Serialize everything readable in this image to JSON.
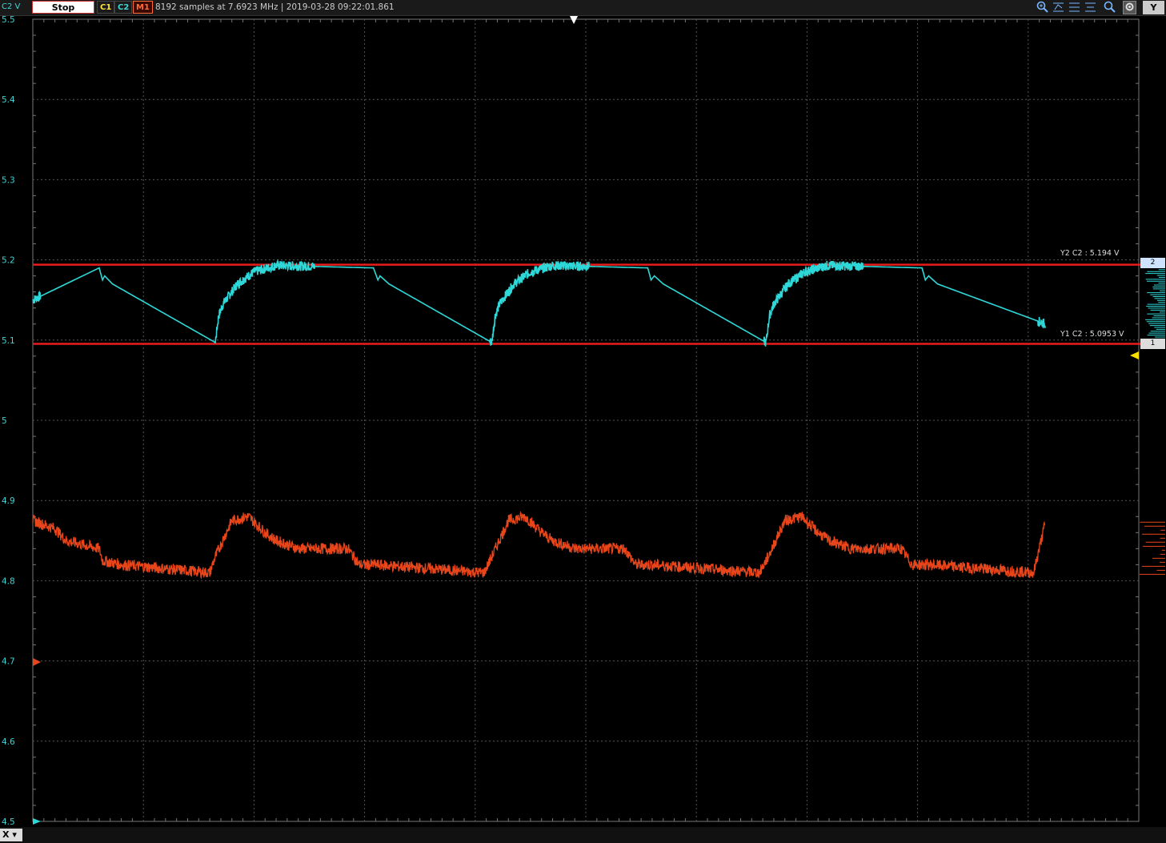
{
  "toolbar": {
    "axis_label": "C2 V",
    "stop_label": "Stop",
    "channels": [
      "C1",
      "C2",
      "M1"
    ],
    "status": "8192 samples at 7.6923 MHz | 2019-03-28 09:22:01.861",
    "y_button": "Y"
  },
  "bottombar": {
    "x_button": "X"
  },
  "cursors": {
    "y2_label": "Y2 C2 : 5.194 V",
    "y1_label": "Y1 C2 : 5.0953 V",
    "y2_tag": "2",
    "y1_tag": "1"
  },
  "colors": {
    "c2": "#2fd8d8",
    "m1": "#e8461a",
    "cursor": "#e81c1c",
    "grid": "#555555"
  },
  "chart_data": {
    "type": "line",
    "xlabel": "",
    "ylabel": "C2 V",
    "xlim": [
      -490,
      510
    ],
    "ylim": [
      4.5,
      5.5
    ],
    "x_unit": "us",
    "x_ticks": [
      "-490 us",
      "-390 us",
      "-290 us",
      "-190 us",
      "-90 us",
      "10 us",
      "110 us",
      "210 us",
      "310 us",
      "410 us",
      "510 us"
    ],
    "y_ticks": [
      "5.5",
      "5.4",
      "5.3",
      "5.2",
      "5.1",
      "5",
      "4.9",
      "4.8",
      "4.7",
      "4.6",
      "4.5"
    ],
    "cursors": [
      {
        "name": "Y2 C2",
        "value": 5.194
      },
      {
        "name": "Y1 C2",
        "value": 5.0953
      }
    ],
    "series": [
      {
        "name": "C2",
        "period_us": 248,
        "min": 5.0953,
        "max": 5.194,
        "x": [
          -490,
          -430,
          -427,
          -425,
          -418,
          -325,
          -322,
          -318,
          -305,
          -290,
          -270,
          -182,
          -178,
          -176,
          -168,
          -75,
          -72,
          -68,
          -55,
          -40,
          -20,
          66,
          69,
          72,
          80,
          173,
          176,
          180,
          193,
          208,
          228,
          314,
          317,
          320,
          328,
          426
        ],
        "values": [
          5.15,
          5.19,
          5.175,
          5.18,
          5.17,
          5.097,
          5.13,
          5.145,
          5.17,
          5.185,
          5.193,
          5.19,
          5.175,
          5.18,
          5.17,
          5.097,
          5.13,
          5.145,
          5.17,
          5.185,
          5.193,
          5.19,
          5.175,
          5.18,
          5.17,
          5.097,
          5.13,
          5.145,
          5.17,
          5.185,
          5.193,
          5.19,
          5.175,
          5.18,
          5.17,
          5.12
        ]
      },
      {
        "name": "M1",
        "x": [
          -490,
          -470,
          -460,
          -430,
          -427,
          -410,
          -330,
          -325,
          -310,
          -295,
          -280,
          -270,
          -250,
          -205,
          -195,
          -180,
          -82,
          -75,
          -60,
          -45,
          -30,
          -20,
          0,
          45,
          55,
          70,
          167,
          175,
          190,
          205,
          220,
          230,
          250,
          295,
          305,
          320,
          415,
          425
        ],
        "values": [
          4.875,
          4.865,
          4.85,
          4.84,
          4.825,
          4.82,
          4.81,
          4.83,
          4.875,
          4.88,
          4.86,
          4.85,
          4.84,
          4.84,
          4.82,
          4.82,
          4.81,
          4.83,
          4.875,
          4.88,
          4.86,
          4.85,
          4.84,
          4.84,
          4.82,
          4.82,
          4.81,
          4.83,
          4.875,
          4.88,
          4.86,
          4.85,
          4.84,
          4.84,
          4.82,
          4.82,
          4.81,
          4.87
        ]
      }
    ]
  }
}
